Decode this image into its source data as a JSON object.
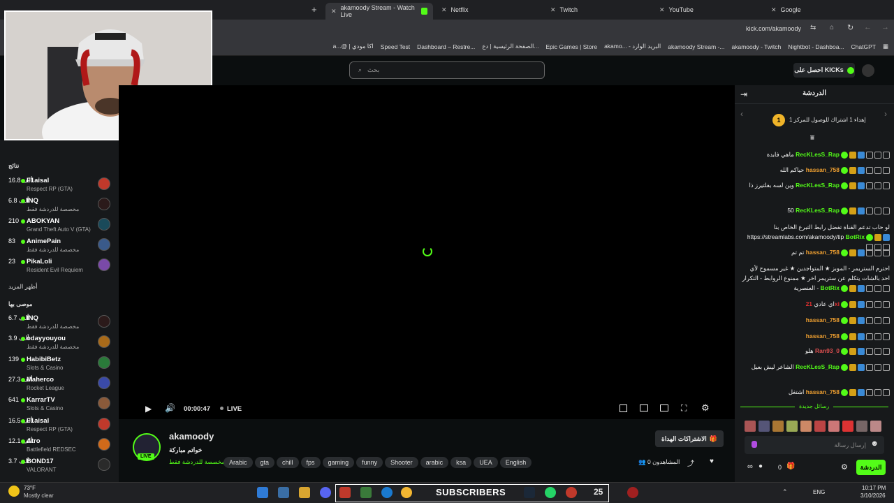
{
  "tabs": [
    {
      "label": "akamoody Stream - Watch Live",
      "active": true
    },
    {
      "label": "Netflix"
    },
    {
      "label": "Twitch"
    },
    {
      "label": "YouTube"
    },
    {
      "label": "Google"
    }
  ],
  "address": {
    "url": "kick.com/akamoody"
  },
  "bookmarks": [
    "a...@ | اكا مودي",
    "Speed Test",
    "Dashboard – Restre...",
    "الصفحة الرئيسية | دع...",
    "Epic Games | Store",
    "akamo... - البريد الوارد",
    "akamoody Stream -...",
    "akamoody - Twitch",
    "Nightbot - Dashboa...",
    "ChatGPT"
  ],
  "header": {
    "search_placeholder": "بحث",
    "get_kicks": "احصل على KICKs"
  },
  "sidebar": {
    "recommended_title": "نتائج",
    "recommended": [
      {
        "count": "16.8 ألف",
        "name": "F1aisal",
        "category": "Respect RP (GTA)",
        "color": "#c0392b"
      },
      {
        "count": "6.8 ألف",
        "name": "INQ",
        "category": "مخصصة للدردشة فقط",
        "color": "#2b1a1a"
      },
      {
        "count": "210",
        "name": "ABOKYAN",
        "category": "Grand Theft Auto V (GTA)",
        "color": "#1a4a5a"
      },
      {
        "count": "83",
        "name": "AnimePain",
        "category": "مخصصة للدردشة فقط",
        "color": "#3a5a8a"
      },
      {
        "count": "23",
        "name": "PikaLoli",
        "category": "Resident Evil Requiem",
        "color": "#7a4aa8"
      }
    ],
    "show_more": "أظهر المزيد",
    "following_title": "موصى بها",
    "following": [
      {
        "count": "6.7 ألف",
        "name": "INQ",
        "category": "مخصصة للدردشة فقط",
        "color": "#2b1a1a"
      },
      {
        "count": "3.9 ألف",
        "name": "odayyouyou",
        "category": "مخصصة للدردشة فقط",
        "color": "#a86a1a"
      },
      {
        "count": "139",
        "name": "HabibiBetz",
        "category": "Slots & Casino",
        "color": "#2a7a3a"
      },
      {
        "count": "27.3 ألف",
        "name": "Maherco",
        "category": "Rocket League",
        "color": "#3a4aa8"
      },
      {
        "count": "641",
        "name": "KarrarTV",
        "category": "Slots & Casino",
        "color": "#8a5a3a"
      },
      {
        "count": "16.5 ألف",
        "name": "F1aisal",
        "category": "Respect RP (GTA)",
        "color": "#c0392b"
      },
      {
        "count": "12.1 ألف",
        "name": "Atro",
        "category": "Battlefield REDSEC",
        "color": "#d06a1a"
      },
      {
        "count": "3.7 ألف",
        "name": "BOND17",
        "category": "VALORANT",
        "color": "#2a2a2a"
      }
    ]
  },
  "player": {
    "time": "00:00:47",
    "live": "LIVE"
  },
  "stream": {
    "channel": "akamoody",
    "title": "خواتم مباركة",
    "category": "مخصصة للدردشة فقط",
    "tags": [
      "Arabic",
      "gta",
      "chill",
      "fps",
      "gaming",
      "funny",
      "Shooter",
      "arabic",
      "ksa",
      "UEA",
      "English"
    ],
    "subscribe_gift": "الاشتراكات الهداة",
    "viewers": "0 المشاهدون",
    "live_badge": "LIVE"
  },
  "chat": {
    "title": "الدردشة",
    "pinned": "إهداء 1 اشتراك للوصول للمركز 1",
    "messages": [
      {
        "user": "RecKLesS_Rap",
        "text": "ماهي فايدة",
        "color": "#53fc18"
      },
      {
        "user": "hassan_758",
        "text": "حياكم الله",
        "color": "#f0a030"
      },
      {
        "user": "RecKLesS_Rap",
        "text": "وين لسه بفلتيرز ذا",
        "color": "#53fc18"
      },
      {
        "user": "RecKLesS_Rap",
        "text": "50",
        "color": "#53fc18"
      },
      {
        "user": "BotRix",
        "text": "لو حاب تدعم القناة تفضل رابط التبرع الخاص بنا https://streamlabs.com/akamoody/tip",
        "color": "#53fc18"
      },
      {
        "user": "hassan_758",
        "text": "تم تم",
        "color": "#f0a030"
      },
      {
        "user": "BotRix",
        "text": "احترم الستريمر - الموبز ★ المتواجدين ★ غير مسموح لأي احد بالشات يتكلم عن ستريمر اخر ★ ممنوع الروابط - التكرار - العنصرية",
        "color": "#53fc18"
      },
      {
        "user": "21xi",
        "text": "اي عادي",
        "color": "#e03030"
      },
      {
        "user": "hassan_758",
        "text": "",
        "color": "#f0a030"
      },
      {
        "user": "hassan_758",
        "text": "",
        "color": "#f0a030"
      },
      {
        "user": "Ran93_0",
        "text": "هلو",
        "color": "#e05050"
      },
      {
        "user": "RecKLesS_Rap",
        "text": "الشاعر ليش بعيل",
        "color": "#53fc18"
      },
      {
        "user": "hassan_758",
        "text": "اشتغل",
        "color": "#f0a030"
      }
    ],
    "new_messages": "رسائل جديدة",
    "input_placeholder": "إرسال رسالة",
    "kicks_count": "0",
    "send_label": "الدردشة"
  },
  "taskbar": {
    "weather_temp": "73°F",
    "weather_desc": "Mostly clear",
    "subscribers": "SUBSCRIBERS",
    "lang": "ENG",
    "time": "10:17 PM",
    "date": "3/10/2026",
    "badge": "25"
  }
}
